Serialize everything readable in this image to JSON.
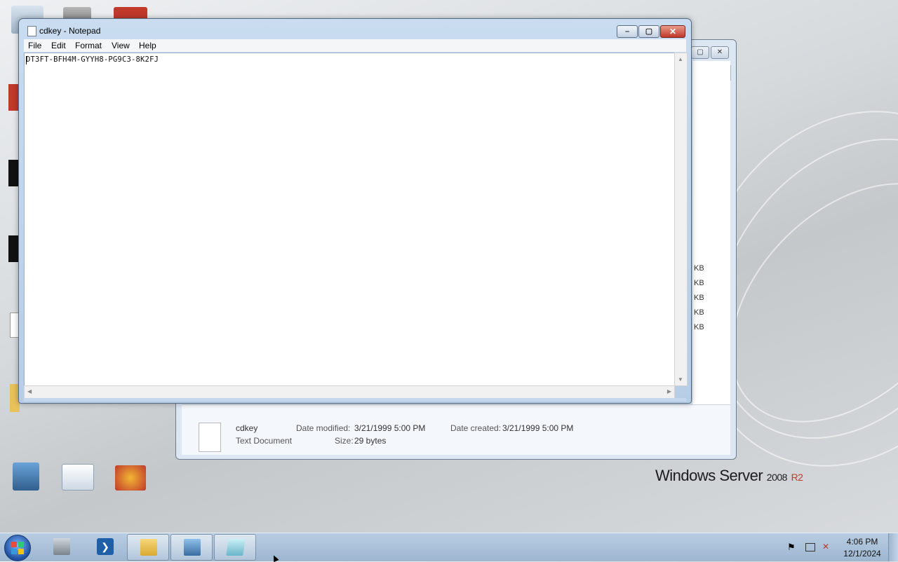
{
  "notepad": {
    "title": "cdkey - Notepad",
    "menu": [
      "File",
      "Edit",
      "Format",
      "View",
      "Help"
    ],
    "content": "DT3FT-BFH4M-GYYH8-PG9C3-8K2FJ"
  },
  "explorer": {
    "size_units": [
      "KB",
      "KB",
      "KB",
      "KB",
      "KB"
    ],
    "details": {
      "name": "cdkey",
      "type": "Text Document",
      "date_modified_label": "Date modified:",
      "date_modified": "3/21/1999 5:00 PM",
      "date_created_label": "Date created:",
      "date_created": "3/21/1999 5:00 PM",
      "size_label": "Size:",
      "size": "29 bytes"
    }
  },
  "branding": {
    "os_name": "Windows Server",
    "version": "2008",
    "edition": "R2"
  },
  "taskbar": {
    "time": "4:06 PM",
    "date": "12/1/2024"
  }
}
